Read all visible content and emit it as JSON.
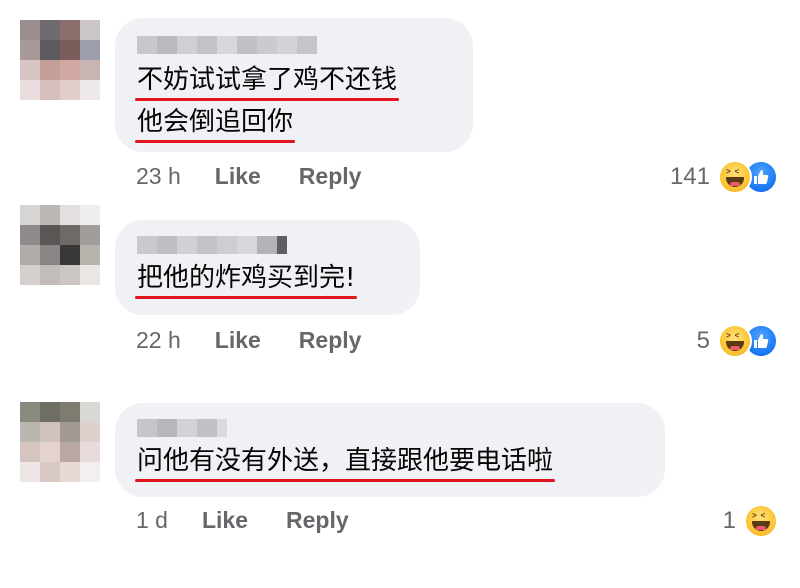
{
  "comments": [
    {
      "lines": [
        "不妨试试拿了鸡不还钱",
        "他会倒追回你"
      ],
      "time": "23 h",
      "like_label": "Like",
      "reply_label": "Reply",
      "reaction_count": "141",
      "reactions": [
        "haha-icon",
        "like-icon"
      ]
    },
    {
      "lines": [
        "把他的炸鸡买到完!"
      ],
      "time": "22 h",
      "like_label": "Like",
      "reply_label": "Reply",
      "reaction_count": "5",
      "reactions": [
        "haha-icon",
        "like-icon"
      ]
    },
    {
      "lines": [
        "问他有没有外送，直接跟他要电话啦"
      ],
      "time": "1 d",
      "like_label": "Like",
      "reply_label": "Reply",
      "reaction_count": "1",
      "reactions": [
        "haha-icon"
      ]
    }
  ],
  "colors": {
    "bubble": "#eff1f4",
    "meta_text": "#65676b",
    "underline": "#e2141d",
    "like_blue": "#1877f2",
    "haha_yellow": "#fcc534"
  }
}
